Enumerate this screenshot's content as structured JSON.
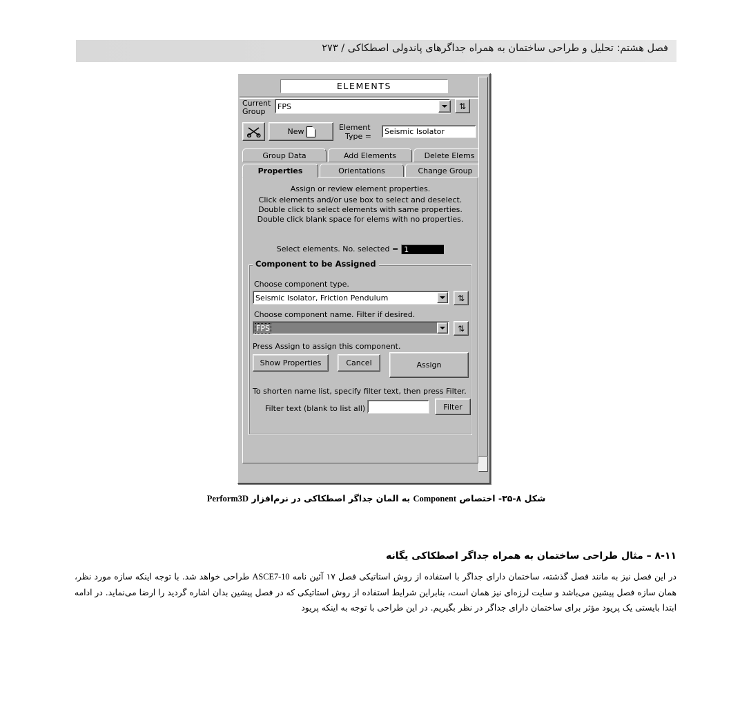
{
  "page_header": {
    "text": "فصل هشتم: تحلیل و طراحی ساختمان به همراه جداگرهای پاندولی اصطکاکی / ۲۷۳"
  },
  "dialog": {
    "title": "ELEMENTS",
    "current_group": {
      "label_line1": "Current",
      "label_line2": "Group",
      "value": "FPS",
      "refresh_icon": "refresh-icon"
    },
    "toolbar": {
      "cut_icon": "scissors-icon",
      "new_label": "New",
      "new_page_icon": "new-page-icon",
      "element_type_label_line1": "Element",
      "element_type_label_line2": "Type =",
      "element_type_value": "Seismic Isolator"
    },
    "tabs_row1": [
      {
        "label": "Group Data",
        "active": false
      },
      {
        "label": "Add Elements",
        "active": false
      },
      {
        "label": "Delete Elems",
        "active": false
      }
    ],
    "tabs_row2": [
      {
        "label": "Properties",
        "active": true
      },
      {
        "label": "Orientations",
        "active": false
      },
      {
        "label": "Change Group",
        "active": false
      }
    ],
    "instructions": [
      "Assign or review element properties.",
      "Click elements and/or use box to select and deselect.",
      "Double click to select elements with same properties.",
      "Double click blank space for elems with no properties."
    ],
    "selection": {
      "label": "Select elements.  No. selected =",
      "count": "1"
    },
    "component_group": {
      "title": "Component to be Assigned",
      "type_label": "Choose component type.",
      "type_value": "Seismic Isolator, Friction Pendulum",
      "type_refresh_icon": "refresh-icon",
      "name_label": "Choose component name. Filter if desired.",
      "name_value": "FPS",
      "name_refresh_icon": "refresh-icon",
      "press_label": "Press Assign to assign this component.",
      "show_properties_button": "Show Properties",
      "cancel_button": "Cancel",
      "assign_button": "Assign",
      "shorten_label": "To shorten name list, specify filter text, then press Filter.",
      "filter_text_label": "Filter text (blank to list all)",
      "filter_text_value": "",
      "filter_button": "Filter"
    }
  },
  "figure_caption": {
    "prefix": "شکل ۸-۳۵- اختصاص ",
    "latin1": "Component",
    "middle": " به المان جداگر اصطکاکی در نرم‌افزار ",
    "latin2": "Perform3D"
  },
  "section": {
    "heading": "۸-۱۱ – مثال طراحی ساختمان به همراه جداگر اصطکاکی یگانه",
    "paragraph_part1": "در این فصل نیز به مانند فصل گذشته، ساختمان دارای جداگر با استفاده از روش استاتیکی فصل ۱۷ آئین نامه ",
    "paragraph_latin": "ASCE7-10",
    "paragraph_part2": " طراحی خواهد شد. با توجه اینکه سازه مورد نظر، همان سازه فصل پیشین می‌باشد و سایت لرزه‌ای نیز همان است، بنابراین شرایط استفاده از روش استاتیکی که در فصل پیشین بدان اشاره گردید را ارضا می‌نماید.  در ادامه ابتدا بایستی یک پریود مؤثر برای ساختمان دارای جداگر در نظر بگیریم. در این طراحی با توجه به اینکه پریود"
  },
  "colors": {
    "dialog_face": "#c0c0c0",
    "header_band": "#dcdcdc",
    "selection_highlight": "#000000",
    "combo_focus": "#808080"
  }
}
